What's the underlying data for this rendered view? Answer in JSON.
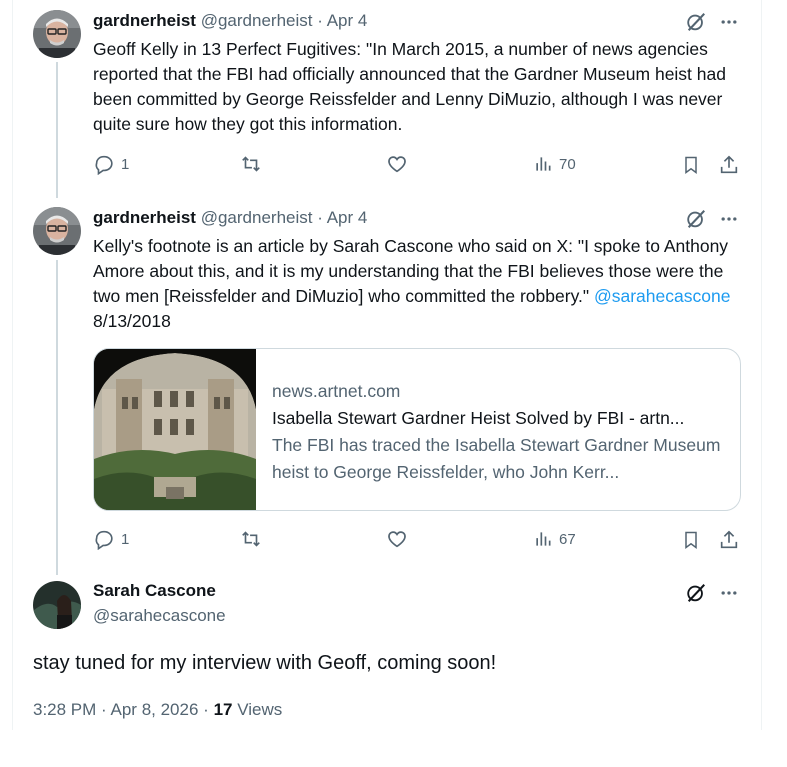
{
  "tweets": [
    {
      "name": "gardnerheist",
      "handle": "@gardnerheist",
      "separator": "·",
      "date": "Apr 4",
      "text": "Geoff Kelly in 13 Perfect Fugitives: \"In March 2015, a number of news agencies reported that the FBI had officially announced that the Gardner Museum heist had been committed by George Reissfelder and Lenny DiMuzio, although I was never quite sure how they got this information.",
      "replies": "1",
      "reposts": "",
      "likes": "",
      "views": "70"
    },
    {
      "name": "gardnerheist",
      "handle": "@gardnerheist",
      "separator": "·",
      "date": "Apr 4",
      "text": "Kelly's footnote is an article by Sarah Cascone who said on X: \"I spoke to Anthony Amore about this, and it is my understanding that the FBI believes those were the two men [Reissfelder and DiMuzio] who committed the robbery.\" ",
      "mention": "@sarahecascone",
      "text_suffix": " 8/13/2018",
      "card": {
        "domain": "news.artnet.com",
        "title": "Isabella Stewart Gardner Heist Solved by FBI - artn...",
        "description": "The FBI has traced the Isabella Stewart Gardner Museum heist to George Reissfelder, who John Kerr..."
      },
      "replies": "1",
      "reposts": "",
      "likes": "",
      "views": "67"
    }
  ],
  "main_tweet": {
    "name": "Sarah Cascone",
    "handle": "@sarahecascone",
    "text": "stay tuned for my interview with Geoff, coming soon!",
    "time": "3:28 PM",
    "separator": "·",
    "date": "Apr 8, 2026",
    "views_count": "17",
    "views_label": "Views"
  },
  "icons": [
    "grok-icon",
    "more-icon",
    "reply-icon",
    "repost-icon",
    "like-icon",
    "views-icon",
    "bookmark-icon",
    "share-icon"
  ],
  "colors": {
    "text": "#0f1419",
    "secondary": "#536471",
    "link": "#1d9bf0",
    "border": "#cfd9de"
  }
}
